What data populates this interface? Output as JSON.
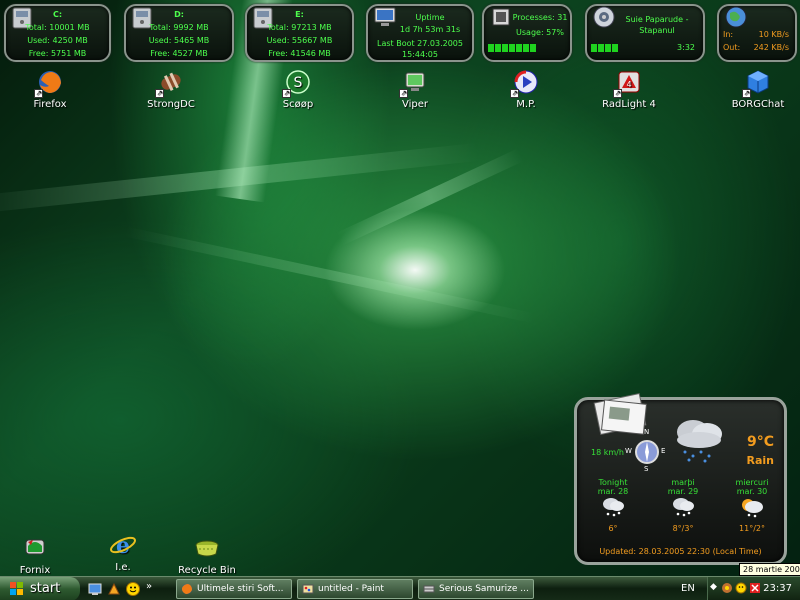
{
  "widgets": {
    "drive_c": {
      "letter": "C:",
      "total": "Total: 10001 MB",
      "used": "Used: 4250 MB",
      "free": "Free: 5751 MB"
    },
    "drive_d": {
      "letter": "D:",
      "total": "Total: 9992 MB",
      "used": "Used: 5465 MB",
      "free": "Free: 4527 MB"
    },
    "drive_e": {
      "letter": "E:",
      "total": "Total: 97213 MB",
      "used": "Used: 55667 MB",
      "free": "Free: 41546 MB"
    },
    "uptime": {
      "title": "Uptime",
      "value": "1d 7h 53m 31s",
      "boot_label": "Last Boot 27.03.2005",
      "boot_time": "15:44:05"
    },
    "cpu": {
      "processes": "Processes: 31",
      "usage": "Usage: 57%",
      "usage_fraction": 0.57
    },
    "media": {
      "track": "Suie Paparude -",
      "artist": "Stapanul",
      "time": "3:32",
      "progress_fraction": 0.35
    },
    "network": {
      "in_label": "In:",
      "in_value": "10 KB/s",
      "out_label": "Out:",
      "out_value": "242 KB/s"
    }
  },
  "desktop_icons": [
    {
      "label": "Firefox",
      "icon": "firefox-icon"
    },
    {
      "label": "StrongDC",
      "icon": "strongdc-icon"
    },
    {
      "label": "Scøøp",
      "icon": "scoop-icon"
    },
    {
      "label": "Viper",
      "icon": "viper-icon"
    },
    {
      "label": "M.P.",
      "icon": "media-player-icon"
    },
    {
      "label": "RadLight 4",
      "icon": "radlight-icon"
    },
    {
      "label": "BORGChat",
      "icon": "borgchat-icon"
    },
    {
      "label": "Fornix",
      "icon": "fornix-icon"
    },
    {
      "label": "I.e.",
      "icon": "internet-explorer-icon"
    },
    {
      "label": "Recycle Bin",
      "icon": "recycle-bin-icon"
    }
  ],
  "weather": {
    "wind": "18 km/h",
    "compass": {
      "n": "N",
      "e": "E",
      "s": "S",
      "w": "W"
    },
    "temperature": "9°C",
    "condition": "Rain",
    "forecast": [
      {
        "day": "Tonight",
        "date": "mar. 28",
        "temp": "6°"
      },
      {
        "day": "marþi",
        "date": "mar. 29",
        "temp": "8°/3°"
      },
      {
        "day": "miercuri",
        "date": "mar. 30",
        "temp": "11°/2°"
      }
    ],
    "updated": "Updated: 28.03.2005 22:30 (Local Time)"
  },
  "taskbar": {
    "start_label": "start",
    "tasks": [
      {
        "label": "Ultimele stiri Soft...",
        "icon": "firefox-icon"
      },
      {
        "label": "untitled - Paint",
        "icon": "paint-icon"
      },
      {
        "label": "Serious Samurize ...",
        "icon": "samurize-icon"
      }
    ],
    "language": "EN",
    "clock": "23:37",
    "tooltip": "28 martie 2005"
  },
  "colors": {
    "accent": "#4dff4d",
    "weather_orange": "#f29c1f",
    "widget_border": "#8a948c"
  }
}
